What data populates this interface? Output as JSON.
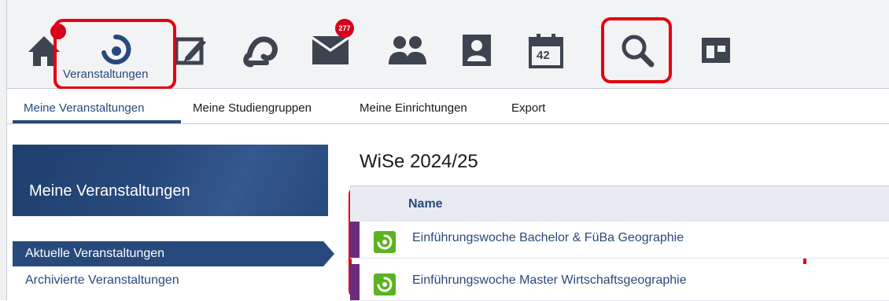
{
  "colors": {
    "brand": "#28497c",
    "highlight": "#e3000f",
    "badge": "#d6001c",
    "course_icon": "#5cb321",
    "row_marker": "#6b2c7e"
  },
  "topnav": {
    "items": [
      {
        "icon": "home-icon",
        "badge": ""
      },
      {
        "icon": "courses-icon",
        "label": "Veranstaltungen",
        "active": true
      },
      {
        "icon": "workspace-icon"
      },
      {
        "icon": "messenger-icon"
      },
      {
        "icon": "mail-icon",
        "badge": "277"
      },
      {
        "icon": "community-icon"
      },
      {
        "icon": "profile-icon"
      },
      {
        "icon": "calendar-icon",
        "text": "42"
      },
      {
        "icon": "search-icon"
      },
      {
        "icon": "tools-icon"
      }
    ]
  },
  "subnav": {
    "items": [
      {
        "label": "Meine Veranstaltungen",
        "active": true
      },
      {
        "label": "Meine Studiengruppen"
      },
      {
        "label": "Meine Einrichtungen"
      },
      {
        "label": "Export"
      }
    ]
  },
  "sidebar": {
    "title": "Meine Veranstaltungen",
    "items": [
      {
        "label": "Aktuelle Veranstaltungen",
        "active": true
      },
      {
        "label": "Archivierte Veranstaltungen"
      }
    ]
  },
  "main": {
    "semester": "WiSe 2024/25",
    "table": {
      "column_name": "Name",
      "rows": [
        {
          "name": "Einführungswoche Bachelor & FüBa Geographie"
        },
        {
          "name": "Einführungswoche Master Wirtschaftsgeographie"
        }
      ]
    }
  }
}
